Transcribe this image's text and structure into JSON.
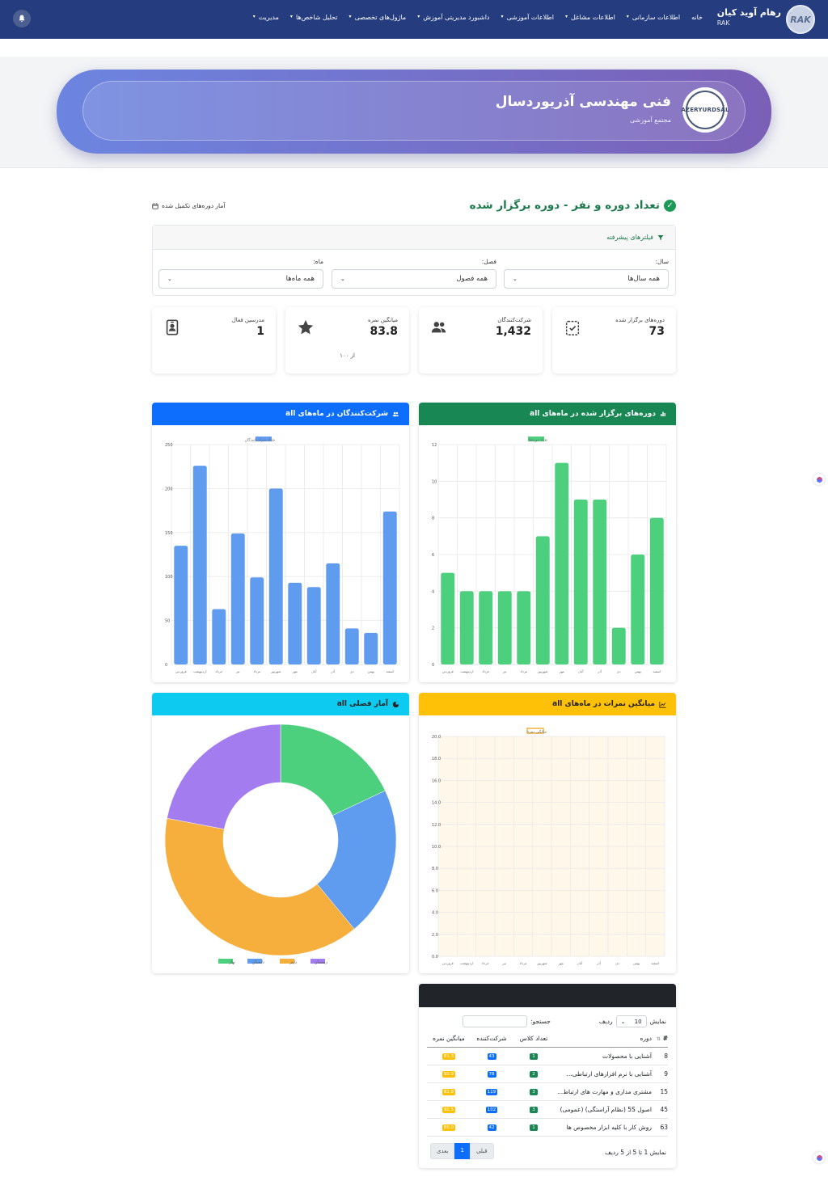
{
  "nav": {
    "brand_name": "رهام آوید کیان",
    "brand_abbr": "RAK",
    "logo_text": "RAK",
    "menu": [
      "خانه",
      "اطلاعات سازمانی",
      "اطلاعات مشاغل",
      "اطلاعات آموزشی",
      "داشبورد مدیریتی آموزش",
      "ماژول‌های تخصصی",
      "تحلیل شاخص‌ها",
      "مدیریت"
    ],
    "bell_icon": "bell-icon"
  },
  "hero": {
    "title": "فنی مهندسی آذریوردسال",
    "subtitle": "مجتمع آموزشی",
    "logo_text": "AZERYURDSAL"
  },
  "page": {
    "title": "تعداد دوره و نفر - دوره برگزار شده",
    "completed_link": "آمار دوره‌های تکمیل شده"
  },
  "filters": {
    "header": "فیلترهای پیشرفته",
    "year_label": "سال:",
    "year_value": "همه سال‌ها",
    "season_label": "فصل:",
    "season_value": "همه فصول",
    "month_label": "ماه:",
    "month_value": "همه ماه‌ها"
  },
  "stats": [
    {
      "label": "دوره‌های برگزار شده",
      "value": "73",
      "icon": "clipboard-check-icon"
    },
    {
      "label": "شرکت‌کنندگان",
      "value": "1,432",
      "icon": "users-icon"
    },
    {
      "label": "میانگین نمره",
      "value": "83.8",
      "extra": "از ۱۰۰",
      "icon": "star-icon"
    },
    {
      "label": "مدرسین فعال",
      "value": "1",
      "icon": "id-badge-icon"
    }
  ],
  "cards": {
    "courses_title": "دوره‌های برگزار شده در ماه‌های all",
    "participants_title": "شرکت‌کنندگان در ماه‌های all",
    "scores_title": "میانگین نمرات در ماه‌های all",
    "seasonal_title": "آمار فصلی all"
  },
  "chart_data": [
    {
      "type": "bar",
      "title": "دوره‌های برگزار شده در ماه‌های all",
      "legend": "تعداد دوره‌ها",
      "color": "#4cd07d",
      "categories": [
        "فروردین",
        "اردیبهشت",
        "خرداد",
        "تیر",
        "مرداد",
        "شهریور",
        "مهر",
        "آبان",
        "آذر",
        "دی",
        "بهمن",
        "اسفند"
      ],
      "values": [
        5,
        4,
        4,
        4,
        4,
        7,
        11,
        9,
        9,
        2,
        6,
        8
      ],
      "ylim": [
        0,
        12
      ],
      "yticks": [
        0,
        2,
        4,
        6,
        8,
        10,
        12
      ],
      "grid": true
    },
    {
      "type": "bar",
      "title": "شرکت‌کنندگان در ماه‌های all",
      "legend": "تعداد شرکت‌کنندگان",
      "color": "#5f9cf0",
      "categories": [
        "فروردین",
        "اردیبهشت",
        "خرداد",
        "تیر",
        "مرداد",
        "شهریور",
        "مهر",
        "آبان",
        "آذر",
        "دی",
        "بهمن",
        "اسفند"
      ],
      "values": [
        135,
        226,
        63,
        149,
        99,
        200,
        93,
        88,
        115,
        41,
        36,
        174
      ],
      "ylim": [
        0,
        250
      ],
      "yticks": [
        0,
        50,
        100,
        150,
        200,
        250
      ],
      "grid": true
    },
    {
      "type": "line",
      "title": "میانگین نمرات در ماه‌های all",
      "legend": "میانگین نمره",
      "color": "#f5b342",
      "categories": [
        "فروردین",
        "اردیبهشت",
        "خرداد",
        "تیر",
        "مرداد",
        "شهریور",
        "مهر",
        "آبان",
        "آذر",
        "دی",
        "بهمن",
        "اسفند"
      ],
      "values": [],
      "ylim": [
        0,
        20
      ],
      "yticks": [
        "0.0",
        "2.0",
        "4.0",
        "6.0",
        "8.0",
        "10.0",
        "12.0",
        "14.0",
        "16.0",
        "18.0",
        "20.0"
      ],
      "grid": true
    },
    {
      "type": "pie",
      "title": "آمار فصلی all",
      "labels": [
        "بهار",
        "تابستان",
        "پاییز",
        "زمستان"
      ],
      "values": [
        18,
        21,
        39,
        22
      ],
      "colors": [
        "#4cd07d",
        "#5f9cf0",
        "#f6ae3c",
        "#a37cf0"
      ]
    }
  ],
  "table": {
    "show_label": "نمایش",
    "rows_label": "ردیف",
    "page_size": "10",
    "search_label": "جستجو:",
    "columns": [
      "#",
      "دوره",
      "تعداد کلاس",
      "شرکت‌کننده",
      "میانگین نمره"
    ],
    "rows": [
      {
        "id": "8",
        "course": "آشنایی با محصولات",
        "classes": "1",
        "participants": "43",
        "score": "81.3"
      },
      {
        "id": "9",
        "course": "آشنایی با نرم افزارهای ارتباطی...",
        "classes": "2",
        "participants": "78",
        "score": "90.9"
      },
      {
        "id": "15",
        "course": "مشتری مداری و مهارت های ارتباط...",
        "classes": "3",
        "participants": "119",
        "score": "82.8"
      },
      {
        "id": "45",
        "course": "اصول 5S (نظام آراستگی) (عمومی)",
        "classes": "3",
        "participants": "102",
        "score": "90.5"
      },
      {
        "id": "63",
        "course": "روش کار با کلیه ابزار مخصوص ها",
        "classes": "1",
        "participants": "42",
        "score": "80.0"
      }
    ],
    "info": "نمایش 1 تا 5 از 5 ردیف",
    "prev": "قبلی",
    "page": "1",
    "next": "بعدی"
  }
}
